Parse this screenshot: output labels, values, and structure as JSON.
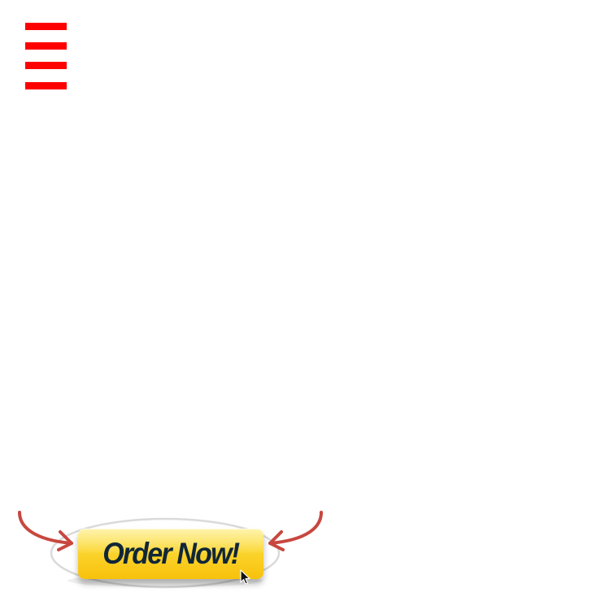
{
  "menu": {
    "icon": "hamburger-menu-icon",
    "color": "#ff0000"
  },
  "order_banner": {
    "label": "Order Now!",
    "button_color_top": "#fde54a",
    "button_color_bottom": "#f8c10b",
    "text_color": "#102638",
    "arrow_color": "#c8473f",
    "ring_color": "#d6d6d6",
    "icons": [
      "left-arrow-icon",
      "right-arrow-icon",
      "mouse-cursor-icon"
    ]
  }
}
